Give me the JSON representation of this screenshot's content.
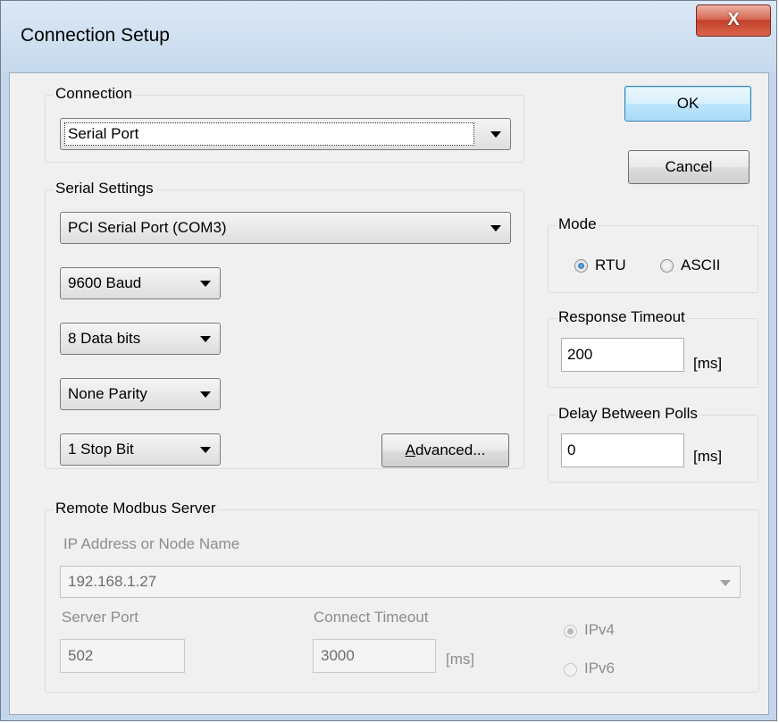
{
  "window": {
    "title": "Connection Setup",
    "close_label": "X"
  },
  "buttons": {
    "ok": "OK",
    "cancel": "Cancel",
    "advanced": "Advanced..."
  },
  "connection": {
    "group_label": "Connection",
    "selected": "Serial Port"
  },
  "serial_settings": {
    "group_label": "Serial Settings",
    "port": "PCI Serial Port (COM3)",
    "baud": "9600 Baud",
    "data_bits": "8 Data bits",
    "parity": "None Parity",
    "stop_bits": "1 Stop Bit"
  },
  "mode": {
    "group_label": "Mode",
    "options": [
      {
        "label": "RTU",
        "checked": true
      },
      {
        "label": "ASCII",
        "checked": false
      }
    ]
  },
  "response_timeout": {
    "group_label": "Response Timeout",
    "value": "200",
    "unit": "[ms]"
  },
  "delay_between_polls": {
    "group_label": "Delay Between Polls",
    "value": "0",
    "unit": "[ms]"
  },
  "remote_server": {
    "group_label": "Remote Modbus Server",
    "ip_label": "IP Address or Node Name",
    "ip_value": "192.168.1.27",
    "port_label": "Server Port",
    "port_value": "502",
    "timeout_label": "Connect Timeout",
    "timeout_value": "3000",
    "timeout_unit": "[ms]",
    "ip_versions": [
      {
        "label": "IPv4",
        "checked": true
      },
      {
        "label": "IPv6",
        "checked": false
      }
    ]
  }
}
